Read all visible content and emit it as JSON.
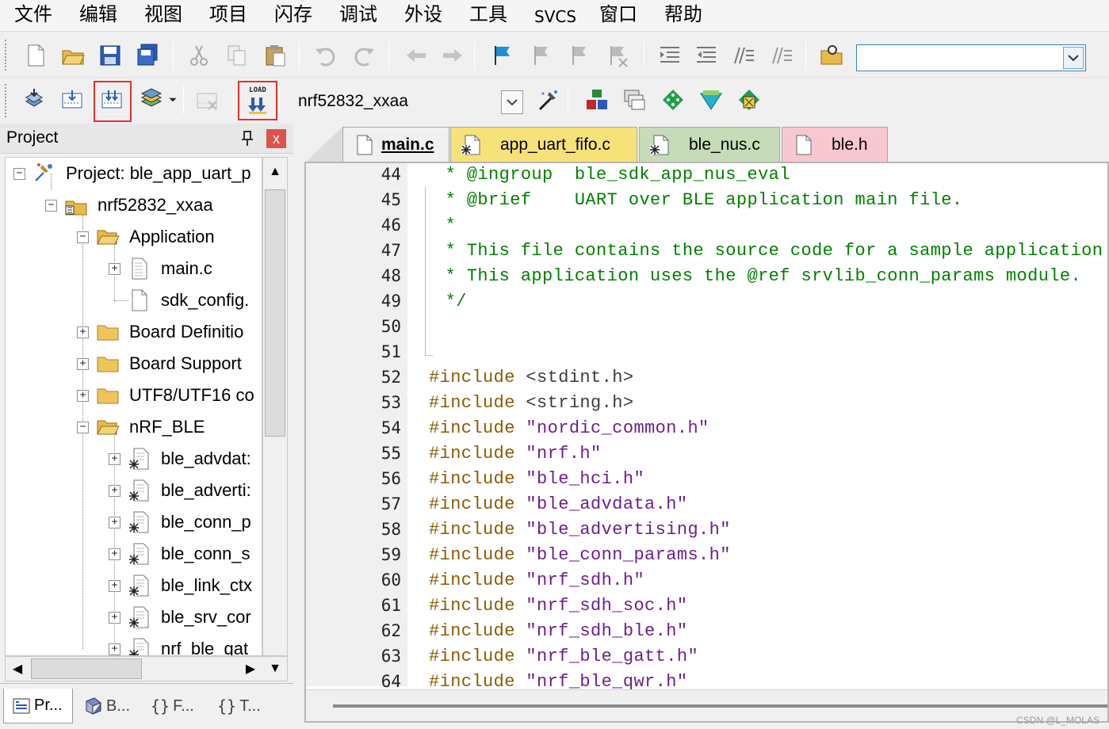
{
  "menu": [
    "文件",
    "编辑",
    "视图",
    "项目",
    "闪存",
    "调试",
    "外设",
    "工具",
    "SVCS",
    "窗口",
    "帮助"
  ],
  "toolbar1": {
    "icons": [
      "new-file-icon",
      "open-folder-icon",
      "save-icon",
      "save-all-icon",
      "cut-icon",
      "copy-icon",
      "paste-icon",
      "undo-icon",
      "redo-icon",
      "nav-back-icon",
      "nav-forward-icon",
      "bookmark-icon",
      "prev-bookmark-icon",
      "next-bookmark-icon",
      "clear-bookmarks-icon",
      "indent-icon",
      "unindent-icon",
      "comment-icon",
      "uncomment-icon",
      "find-in-files-icon"
    ],
    "find_value": ""
  },
  "toolbar2": {
    "icons": [
      "translate-icon",
      "build-icon",
      "rebuild-icon",
      "batch-build-icon",
      "stop-build-icon",
      "download-load-icon",
      "target-options-icon",
      "manage-components-icon",
      "select-packs-icon",
      "pack-installer-icon",
      "manage-run-time-icon",
      "start-debug-icon"
    ],
    "load_icon_text": "LOAD",
    "target_name": "nrf52832_xxaa"
  },
  "project_pane": {
    "title": "Project",
    "close_glyph": "x",
    "tree": [
      {
        "label": "Project: ble_app_uart_p",
        "icon": "project-icon",
        "expander": "−",
        "level": 0
      },
      {
        "label": "nrf52832_xxaa",
        "icon": "target-icon",
        "expander": "−",
        "level": 1
      },
      {
        "label": "Application",
        "icon": "folder-open-icon",
        "expander": "−",
        "level": 2
      },
      {
        "label": "main.c",
        "icon": "c-file-icon",
        "expander": "+",
        "level": 3
      },
      {
        "label": "sdk_config.",
        "icon": "h-file-icon",
        "expander": "",
        "level": 3
      },
      {
        "label": "Board Definitio",
        "icon": "folder-icon",
        "expander": "+",
        "level": 2
      },
      {
        "label": "Board Support",
        "icon": "folder-icon",
        "expander": "+",
        "level": 2
      },
      {
        "label": "UTF8/UTF16 co",
        "icon": "folder-icon",
        "expander": "+",
        "level": 2
      },
      {
        "label": "nRF_BLE",
        "icon": "folder-open-icon",
        "expander": "−",
        "level": 2
      },
      {
        "label": "ble_advdat:",
        "icon": "c-file-lib-icon",
        "expander": "+",
        "level": 3
      },
      {
        "label": "ble_adverti:",
        "icon": "c-file-lib-icon",
        "expander": "+",
        "level": 3
      },
      {
        "label": "ble_conn_p",
        "icon": "c-file-lib-icon",
        "expander": "+",
        "level": 3
      },
      {
        "label": "ble_conn_s",
        "icon": "c-file-lib-icon",
        "expander": "+",
        "level": 3
      },
      {
        "label": "ble_link_ctx",
        "icon": "c-file-lib-icon",
        "expander": "+",
        "level": 3
      },
      {
        "label": "ble_srv_cor",
        "icon": "c-file-lib-icon",
        "expander": "+",
        "level": 3
      },
      {
        "label": "nrf_ble_gat",
        "icon": "c-file-lib-icon",
        "expander": "+",
        "level": 3
      }
    ],
    "bottom_tabs": [
      {
        "label": "Pr...",
        "icon": "project-tab-icon"
      },
      {
        "label": "B...",
        "icon": "books-tab-icon"
      },
      {
        "label": "F...",
        "icon": "functions-tab-icon",
        "prefix": "{}"
      },
      {
        "label": "T...",
        "icon": "templates-tab-icon",
        "prefix": "{}"
      }
    ]
  },
  "editor": {
    "tabs": [
      {
        "label": "main.c",
        "color": "#f0f0f0",
        "active": true
      },
      {
        "label": "app_uart_fifo.c",
        "color": "#f7e27a",
        "active": false
      },
      {
        "label": "ble_nus.c",
        "color": "#c6dcb8",
        "active": false
      },
      {
        "label": "ble.h",
        "color": "#f7c8cf",
        "active": false
      }
    ],
    "lines": [
      {
        "n": "44",
        "parts": [
          [
            "cmt",
            " * @ingroup  ble_sdk_app_nus_eval"
          ]
        ]
      },
      {
        "n": "45",
        "parts": [
          [
            "cmt",
            " * @brief    UART over BLE application main file."
          ]
        ]
      },
      {
        "n": "46",
        "parts": [
          [
            "cmt",
            " *"
          ]
        ]
      },
      {
        "n": "47",
        "parts": [
          [
            "cmt",
            " * This file contains the source code for a sample application"
          ]
        ]
      },
      {
        "n": "48",
        "parts": [
          [
            "cmt",
            " * This application uses the @ref srvlib_conn_params module."
          ]
        ]
      },
      {
        "n": "49",
        "parts": [
          [
            "cmt",
            " */"
          ]
        ]
      },
      {
        "n": "50",
        "parts": []
      },
      {
        "n": "51",
        "parts": []
      },
      {
        "n": "52",
        "parts": [
          [
            "pp",
            "#include "
          ],
          [
            "ang",
            "<stdint.h>"
          ]
        ]
      },
      {
        "n": "53",
        "parts": [
          [
            "pp",
            "#include "
          ],
          [
            "ang",
            "<string.h>"
          ]
        ]
      },
      {
        "n": "54",
        "parts": [
          [
            "pp",
            "#include "
          ],
          [
            "str",
            "\"nordic_common.h\""
          ]
        ]
      },
      {
        "n": "55",
        "parts": [
          [
            "pp",
            "#include "
          ],
          [
            "str",
            "\"nrf.h\""
          ]
        ]
      },
      {
        "n": "56",
        "parts": [
          [
            "pp",
            "#include "
          ],
          [
            "str",
            "\"ble_hci.h\""
          ]
        ]
      },
      {
        "n": "57",
        "parts": [
          [
            "pp",
            "#include "
          ],
          [
            "str",
            "\"ble_advdata.h\""
          ]
        ]
      },
      {
        "n": "58",
        "parts": [
          [
            "pp",
            "#include "
          ],
          [
            "str",
            "\"ble_advertising.h\""
          ]
        ]
      },
      {
        "n": "59",
        "parts": [
          [
            "pp",
            "#include "
          ],
          [
            "str",
            "\"ble_conn_params.h\""
          ]
        ]
      },
      {
        "n": "60",
        "parts": [
          [
            "pp",
            "#include "
          ],
          [
            "str",
            "\"nrf_sdh.h\""
          ]
        ]
      },
      {
        "n": "61",
        "parts": [
          [
            "pp",
            "#include "
          ],
          [
            "str",
            "\"nrf_sdh_soc.h\""
          ]
        ]
      },
      {
        "n": "62",
        "parts": [
          [
            "pp",
            "#include "
          ],
          [
            "str",
            "\"nrf_sdh_ble.h\""
          ]
        ]
      },
      {
        "n": "63",
        "parts": [
          [
            "pp",
            "#include "
          ],
          [
            "str",
            "\"nrf_ble_gatt.h\""
          ]
        ]
      },
      {
        "n": "64",
        "parts": [
          [
            "pp",
            "#include "
          ],
          [
            "str",
            "\"nrf_ble_qwr.h\""
          ]
        ]
      }
    ]
  },
  "watermark": "CSDN @L_MOLAS",
  "colors": {
    "highlight": "#e8312a",
    "comment": "#008000",
    "preprocessor": "#8b5a00",
    "string": "#6e1e8c"
  }
}
